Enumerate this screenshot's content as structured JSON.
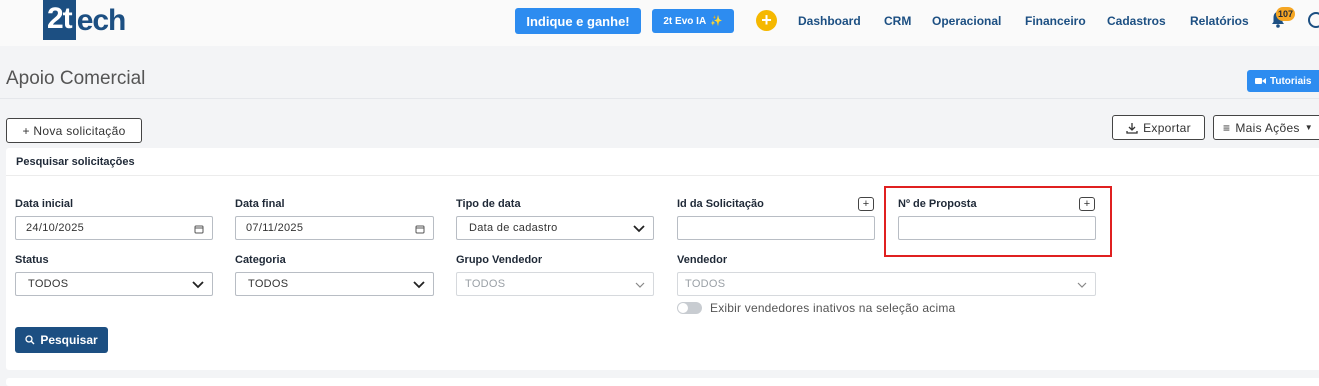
{
  "header": {
    "logo_main": "2t",
    "logo_rest": "ech",
    "indique_label": "Indique e ganhe!",
    "evo_label": "2t Evo IA",
    "evo_sparkle": "✨",
    "add_symbol": "+",
    "nav": [
      "Dashboard",
      "CRM",
      "Operacional",
      "Financeiro",
      "Cadastros",
      "Relatórios"
    ],
    "notification_count": "107",
    "icons": {
      "bell": "bell-icon",
      "user": "user-icon",
      "add": "plus-circle-icon"
    }
  },
  "page": {
    "title": "Apoio Comercial",
    "tutoriais_label": "Tutoriais",
    "nova_solicitacao_label": "+ Nova solicitação",
    "exportar_label": "Exportar",
    "mais_acoes_label": "Mais Ações"
  },
  "search": {
    "title": "Pesquisar solicitações",
    "data_inicial": {
      "label": "Data inicial",
      "value": "24/10/2025"
    },
    "data_final": {
      "label": "Data final",
      "value": "07/11/2025"
    },
    "tipo_data": {
      "label": "Tipo de data",
      "value": "Data de cadastro"
    },
    "id_solicitacao": {
      "label": "Id da Solicitação",
      "value": "",
      "plus": "+"
    },
    "num_proposta": {
      "label": "Nº de Proposta",
      "value": "",
      "plus": "+"
    },
    "status": {
      "label": "Status",
      "value": "TODOS"
    },
    "categoria": {
      "label": "Categoria",
      "value": "TODOS"
    },
    "grupo_vendedor": {
      "label": "Grupo Vendedor",
      "value": "TODOS"
    },
    "vendedor": {
      "label": "Vendedor",
      "value": "TODOS"
    },
    "toggle_label": "Exibir vendedores inativos na seleção acima",
    "toggle_on": false,
    "pesquisar_label": "Pesquisar"
  },
  "colors": {
    "brand": "#1c4f82",
    "accent": "#2d8cf0",
    "highlight": "#e02020",
    "yellow": "#f5b800"
  }
}
